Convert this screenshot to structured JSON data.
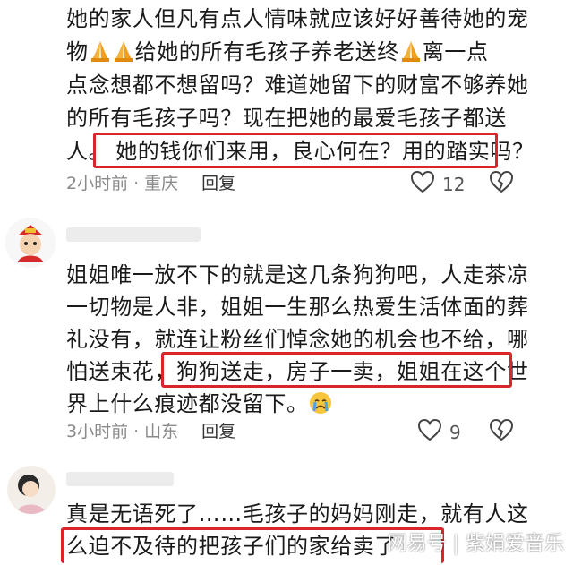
{
  "comment1": {
    "lines": [
      "她的家人但凡有点人情味就应该好好善待她的宠",
      "物",
      "给她的所有毛孩子养老送终",
      "离一点",
      "点念想都不想留吗？难道她留下的财富不够养她",
      "的所有毛孩子吗？现在把她的最爱毛孩子都送",
      "人。",
      "她的钱你们来用，良心何在？用的踏实吗？"
    ],
    "time": "2小时前",
    "location": "重庆",
    "reply_label": "回复",
    "like_count": "12"
  },
  "comment2": {
    "lines": [
      "姐姐唯一放不下的就是这几条狗狗吧，人走茶凉",
      "一切物是人非，姐姐一生那么热爱生活体面的葬",
      "礼没有，就连让粉丝们悼念她的机会也不给，哪",
      "怕送束花，",
      "狗狗送走，房子一卖，姐姐在这个世",
      "界上什么痕迹都没留下。"
    ],
    "time": "3小时前",
    "location": "山东",
    "reply_label": "回复",
    "like_count": "9"
  },
  "comment3": {
    "lines": [
      "真是无语死了……毛孩子的妈妈刚走，就有人这",
      "么迫不及待的把孩子们的家给卖了"
    ]
  },
  "watermark": "网易号 | 紫娟爱音乐",
  "colors": {
    "highlight": "#d8262c",
    "meta": "#8a8a8a"
  },
  "icons": [
    "praying-hands-icon",
    "heart-icon",
    "dislike-heart-icon",
    "crying-face-icon"
  ]
}
